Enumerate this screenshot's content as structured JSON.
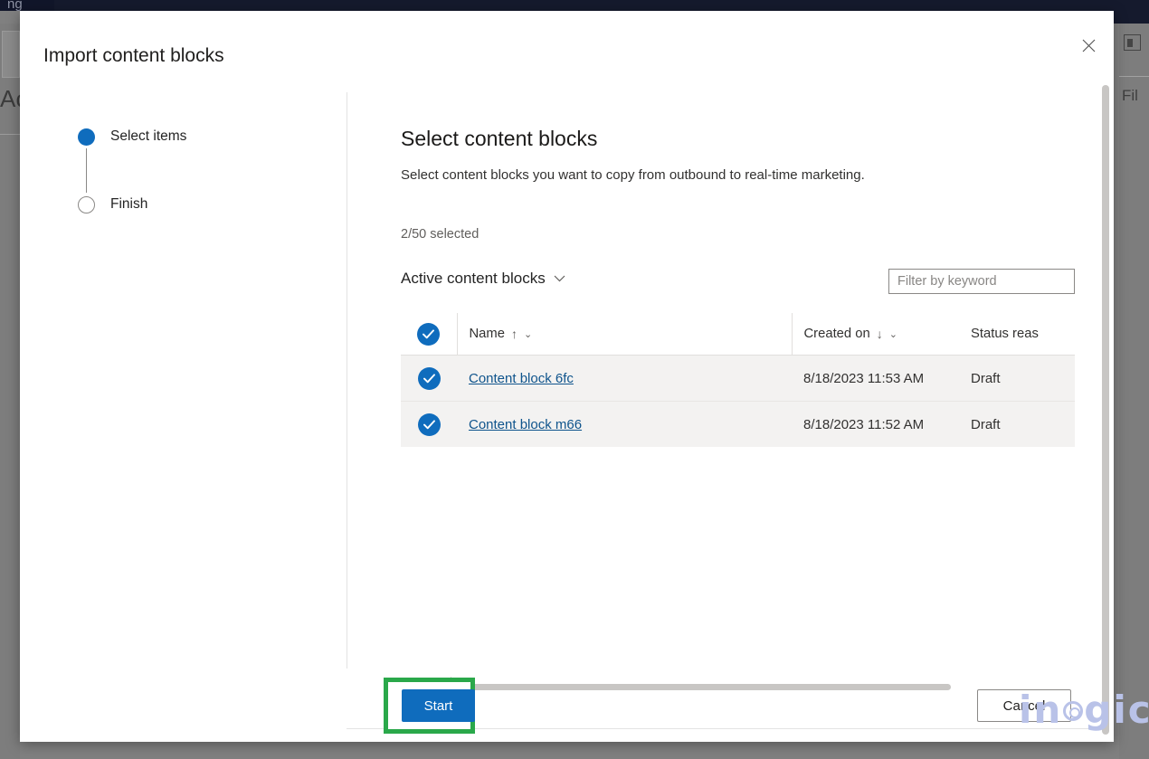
{
  "background": {
    "fragment_top_left": "ng",
    "fragment_heading": "Ac",
    "fragment_right": "Fil"
  },
  "dialog": {
    "title": "Import content blocks",
    "close_icon": "close-icon"
  },
  "wizard": {
    "steps": [
      {
        "label": "Select items",
        "state": "active"
      },
      {
        "label": "Finish",
        "state": "inactive"
      }
    ]
  },
  "pane": {
    "title": "Select content blocks",
    "subtitle": "Select content blocks you want to copy from outbound to real-time marketing.",
    "selected_count": "2/50 selected"
  },
  "viewbar": {
    "view_label": "Active content blocks",
    "view_chevron": "chevron-down-icon",
    "filter_placeholder": "Filter by keyword",
    "filter_value": ""
  },
  "table": {
    "columns": [
      {
        "key": "name",
        "label": "Name",
        "sort": "↑",
        "chevron": "⌄"
      },
      {
        "key": "created",
        "label": "Created on",
        "sort": "↓",
        "chevron": "⌄"
      },
      {
        "key": "status",
        "label": "Status reas",
        "sort": "",
        "chevron": ""
      }
    ],
    "rows": [
      {
        "name": "Content block 6fc",
        "created": "8/18/2023 11:53 AM",
        "status": "Draft",
        "selected": true
      },
      {
        "name": "Content block m66",
        "created": "8/18/2023 11:52 AM",
        "status": "Draft",
        "selected": true
      }
    ],
    "select_all_checked": true
  },
  "footer": {
    "start_label": "Start",
    "cancel_label": "Cancel"
  },
  "watermark": {
    "text_before": "in",
    "text_after": "gic"
  },
  "colors": {
    "accent_blue": "#0f6cbd",
    "link_blue": "#0f548c",
    "highlight_green": "#2aa84a",
    "row_bg": "#f3f2f1",
    "watermark": "#b9c2e8"
  }
}
